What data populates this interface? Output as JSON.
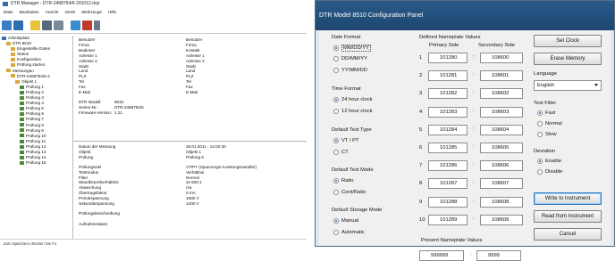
{
  "left_window": {
    "title": "DTR Manager - DTR-2468754/6-201012.dxp",
    "menu": [
      "Datei",
      "Bearbeiten",
      "Ansicht",
      "Gerät",
      "Werkzeuge",
      "Hilfe"
    ],
    "toolbar_icons": [
      "new-file-icon",
      "open-file-icon",
      "save-icon",
      "print-icon",
      "preview-icon",
      "config-icon",
      "delete-icon",
      "dropdown-icon"
    ],
    "tree": [
      {
        "indent": 0,
        "label": "Arbeitsplatz"
      },
      {
        "indent": 1,
        "label": "DTR 8510"
      },
      {
        "indent": 2,
        "label": "Eingestellte Daten"
      },
      {
        "indent": 2,
        "label": "Status"
      },
      {
        "indent": 2,
        "label": "Konfiguration"
      },
      {
        "indent": 2,
        "label": "Prüfung starten"
      },
      {
        "indent": 1,
        "label": "Messungen"
      },
      {
        "indent": 2,
        "label": "DTR-2468754/6-2"
      },
      {
        "indent": 3,
        "label": "Objekt 1"
      },
      {
        "indent": 4,
        "label": "Prüfung 1"
      },
      {
        "indent": 4,
        "label": "Prüfung 2"
      },
      {
        "indent": 4,
        "label": "Prüfung 3"
      },
      {
        "indent": 4,
        "label": "Prüfung 4"
      },
      {
        "indent": 4,
        "label": "Prüfung 5"
      },
      {
        "indent": 4,
        "label": "Prüfung 6"
      },
      {
        "indent": 4,
        "label": "Prüfung 7"
      },
      {
        "indent": 4,
        "label": "Prüfung 8"
      },
      {
        "indent": 4,
        "label": "Prüfung 9"
      },
      {
        "indent": 4,
        "label": "Prüfung 10"
      },
      {
        "indent": 4,
        "label": "Prüfung 11"
      },
      {
        "indent": 4,
        "label": "Prüfung 12"
      },
      {
        "indent": 4,
        "label": "Prüfung 13"
      },
      {
        "indent": 4,
        "label": "Prüfung 14"
      },
      {
        "indent": 4,
        "label": "Prüfung 15"
      }
    ],
    "props_top": [
      [
        "Benutzer",
        "Benutzer"
      ],
      [
        "Firma",
        "Firma"
      ],
      [
        "Bediener",
        "Kontakt"
      ],
      [
        "Adresse 1",
        "Adresse 1"
      ],
      [
        "Adresse 2",
        "Adresse 2"
      ],
      [
        "Stadt",
        "Stadt"
      ],
      [
        "Land",
        "Land"
      ],
      [
        "PLZ",
        "PLZ"
      ],
      [
        "Tel",
        "Tel"
      ],
      [
        "Fax",
        "Fax"
      ],
      [
        "E-Mail",
        "E-Mail"
      ]
    ],
    "device_info": [
      [
        "DTR Modell:",
        "8510"
      ],
      [
        "Serien-Nr.:",
        "DTR-2468754/6"
      ],
      [
        "Firmware-Version:",
        "1.21"
      ]
    ],
    "props_bottom": [
      [
        "Datum der Messung",
        "28.01.2011 - 14:02:30"
      ],
      [
        "Objekt",
        "Objekt 1"
      ],
      [
        "Prüfung",
        "Prüfung 6"
      ]
    ],
    "props_detail": [
      [
        "Prüfungsziel",
        "VT/PT (Spannungs-/Leistungswandler)"
      ],
      [
        "Testmodus",
        "Verhältnis"
      ],
      [
        "Filter",
        "Normal"
      ],
      [
        "",
        ""
      ],
      [
        "Wandlerprüfverhältnis",
        "3x 600:1"
      ],
      [
        "Abweichung",
        "n/a"
      ],
      [
        "Übertragsfaktor",
        "0 mA"
      ],
      [
        "Primärspannung",
        "1600 V"
      ],
      [
        "Sekundärspannung",
        "1200 V"
      ]
    ],
    "notes": [
      "Prüfungsbeschreibung",
      "",
      "Aufnahmedaten"
    ],
    "status": "Zum Speichern drücken Sie F1"
  },
  "dialog": {
    "title": "DTR Model 8510 Configuration Panel",
    "date_format": {
      "title": "Date Format",
      "options": [
        "MM/DD/YY",
        "DD/MM/YY",
        "YY/MM/DD"
      ],
      "selected": 0
    },
    "time_format": {
      "title": "Time Format",
      "options": [
        "24 hour clock",
        "12 hour clock"
      ],
      "selected": 0
    },
    "test_type": {
      "title": "Default Test Type",
      "options": [
        "VT / PT",
        "CT"
      ],
      "selected": 0
    },
    "test_mode": {
      "title": "Default Test Mode",
      "options": [
        "Ratio",
        "Cont/Ratio"
      ],
      "selected": 0
    },
    "storage_mode": {
      "title": "Default Storage Mode",
      "options": [
        "Manual",
        "Automatic"
      ],
      "selected": 0
    },
    "nameplate": {
      "title": "Defined Nameplate Values",
      "col_primary": "Primary Side",
      "col_secondary": "Secondary Side",
      "rows": [
        {
          "n": "1",
          "primary": "101280",
          "secondary": "108600"
        },
        {
          "n": "2",
          "primary": "101281",
          "secondary": "108601"
        },
        {
          "n": "3",
          "primary": "101282",
          "secondary": "108602"
        },
        {
          "n": "4",
          "primary": "101283",
          "secondary": "108603"
        },
        {
          "n": "5",
          "primary": "101284",
          "secondary": "108604"
        },
        {
          "n": "6",
          "primary": "101285",
          "secondary": "108605"
        },
        {
          "n": "7",
          "primary": "101286",
          "secondary": "108606"
        },
        {
          "n": "8",
          "primary": "101287",
          "secondary": "108607"
        },
        {
          "n": "9",
          "primary": "101288",
          "secondary": "108608"
        },
        {
          "n": "10",
          "primary": "101289",
          "secondary": "108609"
        }
      ]
    },
    "present_nameplate": {
      "title": "Present Nameplate Values",
      "primary": "999999",
      "secondary": "9999"
    },
    "buttons": {
      "set_clock": "Set Clock",
      "erase_memory": "Erase Memory",
      "write": "Write to Instrument",
      "read": "Read from Instrument",
      "cancel": "Cancel"
    },
    "language": {
      "title": "Language",
      "value": "English"
    },
    "test_filter": {
      "title": "Test Filter",
      "options": [
        "Fast",
        "Normal",
        "Slow"
      ],
      "selected": 0
    },
    "deviation": {
      "title": "Deviation",
      "options": [
        "Enable",
        "Disable"
      ],
      "selected": 0
    }
  }
}
